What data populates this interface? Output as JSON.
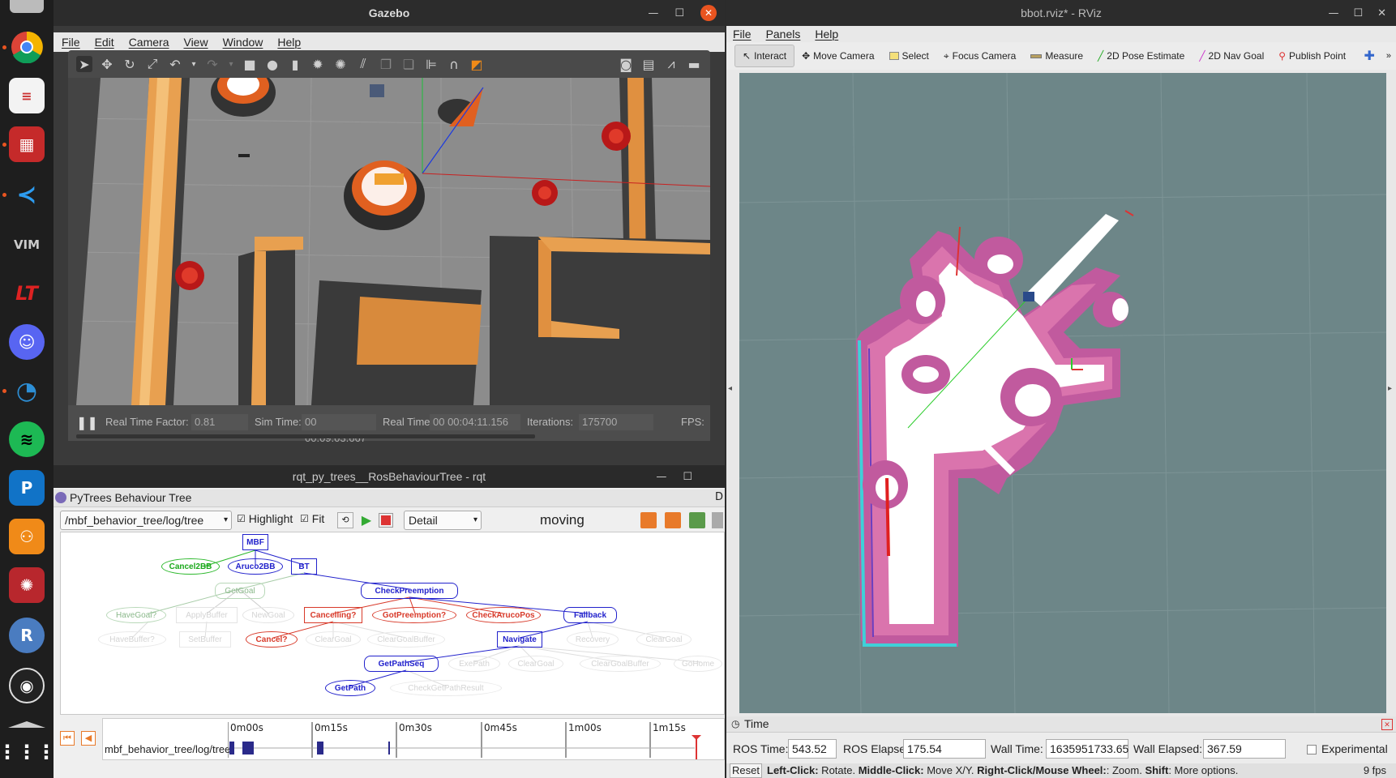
{
  "dock": {
    "items": [
      "chrome",
      "text-editor",
      "presentation",
      "vscode",
      "vim-app",
      "lt-app",
      "discord",
      "ci-app",
      "spotify",
      "p-app",
      "network-app",
      "mendeley",
      "r-app",
      "obs",
      "apps-grid"
    ]
  },
  "gazebo": {
    "title": "Gazebo",
    "menu": [
      "File",
      "Edit",
      "Camera",
      "View",
      "Window",
      "Help"
    ],
    "status": {
      "rtf_label": "Real Time Factor:",
      "rtf_value": "0.81",
      "sim_label": "Sim Time:",
      "sim_value": "00 00:09:03.667",
      "real_label": "Real Time:",
      "real_value": "00 00:04:11.156",
      "iter_label": "Iterations:",
      "iter_value": "175700",
      "fps_label": "FPS:"
    }
  },
  "rqt": {
    "title": "rqt_py_trees__RosBehaviourTree - rqt",
    "plugin_title": "PyTrees Behaviour Tree",
    "plugin_close": "D",
    "topic": "/mbf_behavior_tree/log/tree",
    "highlight_label": "Highlight",
    "fit_label": "Fit",
    "mode": "Detail",
    "state_text": "moving",
    "nodes": {
      "mbf": "MBF",
      "cancel2bb": "Cancel2BB",
      "aruco2bb": "Aruco2BB",
      "bt": "BT",
      "getgoal": "GetGoal",
      "checkpreemption": "CheckPreemption",
      "havegoal": "HaveGoal?",
      "applybuffer": "ApplyBuffer",
      "newgoal": "NewGoal",
      "cancelling": "Cancelling?",
      "gotpreemption": "GotPreemption?",
      "checkarucopos": "CheckArucoPos",
      "fallback": "Fallback",
      "havebuffer": "HaveBuffer?",
      "setbuffer": "SetBuffer",
      "cancel": "Cancel?",
      "cleargoal1": "ClearGoal",
      "cleargoalbuffer1": "ClearGoalBuffer",
      "navigate": "Navigate",
      "recovery": "Recovery",
      "cleargoal2": "ClearGoal",
      "getpathseq": "GetPathSeq",
      "exepath": "ExePath",
      "cleargoal3": "ClearGoal",
      "cleargoalbuffer2": "ClearGoalBuffer",
      "gohome": "GoHome",
      "getpath": "GetPath",
      "checkgetpathresult": "CheckGetPathResult"
    },
    "timeline": {
      "ticks": [
        "0m00s",
        "0m15s",
        "0m30s",
        "0m45s",
        "1m00s",
        "1m15s"
      ],
      "row_label": "mbf_behavior_tree/log/tree"
    }
  },
  "rviz": {
    "title": "bbot.rviz* - RViz",
    "menu": [
      "File",
      "Panels",
      "Help"
    ],
    "tools": [
      "Interact",
      "Move Camera",
      "Select",
      "Focus Camera",
      "Measure",
      "2D Pose Estimate",
      "2D Nav Goal",
      "Publish Point"
    ],
    "time": {
      "panel_title": "Time",
      "ros_time_label": "ROS Time:",
      "ros_time": "543.52",
      "ros_elapsed_label": "ROS Elapsed:",
      "ros_elapsed": "175.54",
      "wall_time_label": "Wall Time:",
      "wall_time": "1635951733.65",
      "wall_elapsed_label": "Wall Elapsed:",
      "wall_elapsed": "367.59",
      "experimental_label": "Experimental",
      "reset_label": "Reset",
      "help_bold1": "Left-Click:",
      "help_1": " Rotate. ",
      "help_bold2": "Middle-Click:",
      "help_2": " Move X/Y. ",
      "help_bold3": "Right-Click/Mouse Wheel:",
      "help_3": ": Zoom. ",
      "help_bold4": "Shift",
      "help_4": ": More options.",
      "fps": "9 fps"
    }
  }
}
